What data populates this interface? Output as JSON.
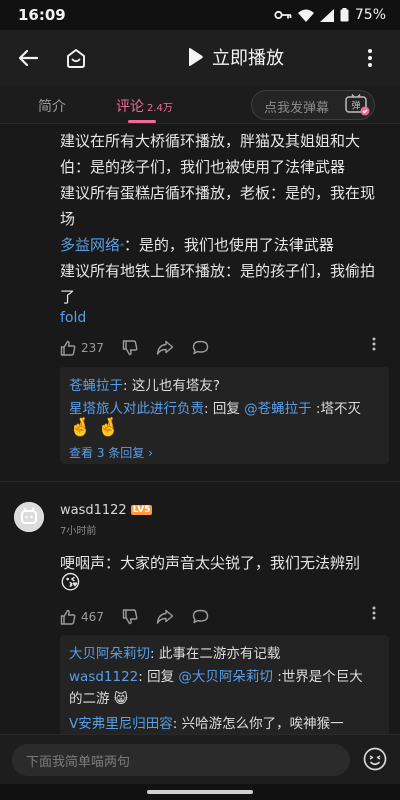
{
  "status_bar": {
    "time": "16:09",
    "battery": "75%"
  },
  "header": {
    "title": "立即播放"
  },
  "tabs": {
    "intro": "简介",
    "comments": "评论",
    "comments_count": "2.4万",
    "danmaku_placeholder": "点我发弹幕",
    "danmaku_icon_text": "弹"
  },
  "comment1": {
    "lines": [
      "建议在所有大桥循环播放，胖猫及其姐姐和大",
      "伯：是的孩子们，我们也被使用了法律武器",
      "建议所有蛋糕店循环播放，老板：是的，我在现",
      "场"
    ],
    "mention_name": "多益网络",
    "mention_mark": "ᐢ",
    "mention_rest": "：是的，我们也使用了法律武器",
    "lines2": [
      "建议所有地铁上循环播放：是的孩子们，我偷拍",
      "了"
    ],
    "fold": "fold",
    "likes": "237",
    "replies": {
      "r1_user": "苍蝇拉于",
      "r1_text": ": 这儿也有塔友?",
      "r2_user": "星塔旅人对此进行负责",
      "r2_reply": ": 回复 ",
      "r2_mention": "@苍蝇拉于",
      "r2_text": " :塔不灭",
      "r2_emoji": "🤞 🤞",
      "view_more": "查看 3 条回复 ›"
    }
  },
  "comment2": {
    "username": "wasd1122",
    "level": "LV5",
    "time": "7小时前",
    "text": "哽咽声：大家的声音太尖锐了，我们无法辨别",
    "emoji": "😘",
    "likes": "467",
    "replies": {
      "r1_user": "大贝阿朵莉切",
      "r1_text": ": 此事在二游亦有记载",
      "r2_user": "wasd1122",
      "r2_reply": ": 回复 ",
      "r2_mention": "@大贝阿朵莉切",
      "r2_text": " :世界是个巨大",
      "r2_line2": "的二游 😸",
      "r3_user": "V安弗里尼归田容",
      "r3_text": ": 兴哈游怎么你了，唉神猴一"
    }
  },
  "bottom": {
    "placeholder": "下面我简单喵两句"
  }
}
